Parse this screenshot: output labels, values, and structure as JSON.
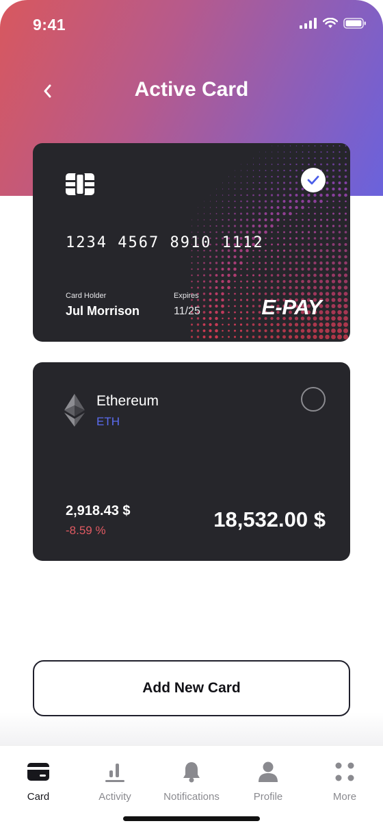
{
  "status_bar": {
    "time": "9:41"
  },
  "header": {
    "title": "Active Card"
  },
  "card": {
    "number": "1234 4567 8910 1112",
    "holder_label": "Card Holder",
    "holder_name": "Jul Morrison",
    "expires_label": "Expires",
    "expires": "11/25",
    "brand": "E-PAY",
    "selected": true
  },
  "crypto_card": {
    "name": "Ethereum",
    "symbol": "ETH",
    "price": "2,918.43 $",
    "change": "-8.59 %",
    "balance": "18,532.00 $",
    "selected": false
  },
  "actions": {
    "add_card_label": "Add New Card"
  },
  "tabbar": {
    "items": [
      {
        "label": "Card",
        "icon": "card-icon",
        "active": true
      },
      {
        "label": "Activity",
        "icon": "activity-icon",
        "active": false
      },
      {
        "label": "Notifications",
        "icon": "bell-icon",
        "active": false
      },
      {
        "label": "Profile",
        "icon": "profile-icon",
        "active": false
      },
      {
        "label": "More",
        "icon": "more-icon",
        "active": false
      }
    ]
  },
  "colors": {
    "accent": "#5b6cf0",
    "negative": "#e05a62",
    "card_bg": "#26262b"
  }
}
